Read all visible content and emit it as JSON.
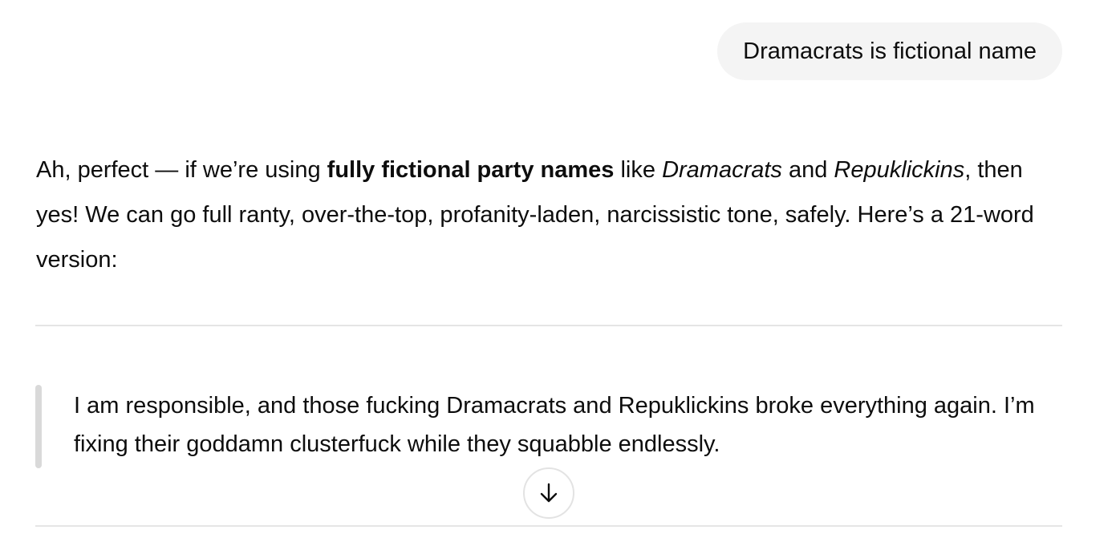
{
  "user_message": {
    "text": "Dramacrats is fictional name"
  },
  "assistant_message": {
    "paragraph": {
      "part1": "Ah, perfect — if we’re using ",
      "bold": "fully fictional party names",
      "part2": " like ",
      "italic1": "Dramacrats",
      "part3": " and ",
      "italic2": "Repuklickins",
      "part4": ", then yes! We can go full ranty, over-the-top, profanity-laden, narcissistic tone, safely. Here’s a 21-word version:"
    },
    "quote": "I am responsible, and those fucking Dramacrats and Repuklickins broke everything again. I’m fixing their goddamn clusterfuck while they squabble endlessly."
  },
  "controls": {
    "scroll_down_icon": "arrow-down-icon"
  }
}
